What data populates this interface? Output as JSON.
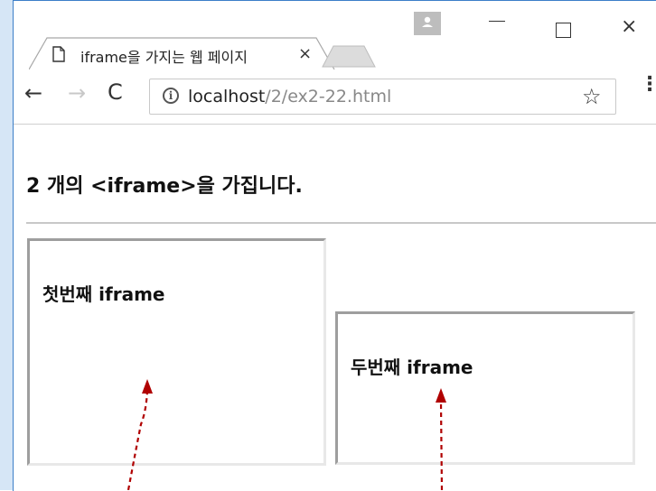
{
  "browser": {
    "tab": {
      "title": "iframe을 가지는 웹 페이지",
      "close_symbol": "×"
    },
    "window_controls": {
      "close_symbol": "×"
    },
    "toolbar": {
      "back_symbol": "←",
      "forward_symbol": "→",
      "reload_symbol": "C",
      "info_symbol": "i",
      "url_host": "localhost",
      "url_path": "/2/ex2-22.html",
      "star_symbol": "☆",
      "menu_symbol": "⋮"
    }
  },
  "page": {
    "heading": "2 개의 <iframe>을 가집니다.",
    "iframes": [
      {
        "text": "첫번째 iframe"
      },
      {
        "text": "두번째 iframe"
      }
    ]
  },
  "colors": {
    "window_border": "#3c7fc8",
    "left_strip": "#d6e6f6",
    "arrow": "#b00000"
  },
  "icons": [
    "document-icon",
    "close-icon",
    "new-tab-icon",
    "profile-icon",
    "minimize-icon",
    "maximize-icon",
    "window-close-icon",
    "back-arrow-icon",
    "forward-arrow-icon",
    "reload-icon",
    "info-icon",
    "bookmark-star-icon",
    "menu-dots-icon"
  ]
}
